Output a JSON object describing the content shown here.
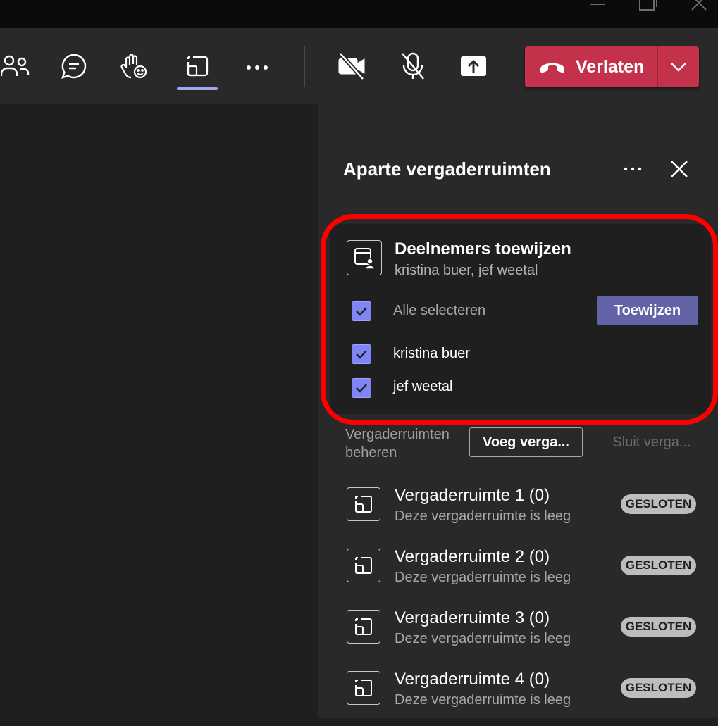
{
  "window": {
    "controls": [
      "minimize",
      "restore",
      "close"
    ]
  },
  "toolbar": {
    "icons": [
      "people-icon",
      "chat-icon",
      "raise-hand-icon",
      "breakout-rooms-icon",
      "more-icon",
      "camera-off-icon",
      "mic-off-icon",
      "share-icon"
    ],
    "active_item": "breakout-rooms",
    "leave_label": "Verlaten",
    "leave_color": "#c4314b"
  },
  "panel": {
    "title": "Aparte vergaderruimten",
    "assign": {
      "title": "Deelnemers toewijzen",
      "subtitle": "kristina buer, jef weetal",
      "select_all": {
        "label": "Alle selecteren",
        "checked": true
      },
      "assign_button": "Toewijzen",
      "participants": [
        {
          "name": "kristina buer",
          "checked": true
        },
        {
          "name": "jef weetal",
          "checked": true
        }
      ]
    },
    "manage": {
      "label": "Vergaderruimten beheren",
      "add_button": "Voeg verga...",
      "close_button": "Sluit verga..."
    },
    "rooms": [
      {
        "name": "Vergaderruimte 1 (0)",
        "description": "Deze vergaderruimte is leeg",
        "status": "GESLOTEN"
      },
      {
        "name": "Vergaderruimte 2 (0)",
        "description": "Deze vergaderruimte is leeg",
        "status": "GESLOTEN"
      },
      {
        "name": "Vergaderruimte 3 (0)",
        "description": "Deze vergaderruimte is leeg",
        "status": "GESLOTEN"
      },
      {
        "name": "Vergaderruimte 4 (0)",
        "description": "Deze vergaderruimte is leeg",
        "status": "GESLOTEN"
      }
    ]
  },
  "colors": {
    "accent": "#6264a7",
    "checkbox": "#7f85f5",
    "highlight": "#ff0000",
    "leave": "#c4314b"
  }
}
